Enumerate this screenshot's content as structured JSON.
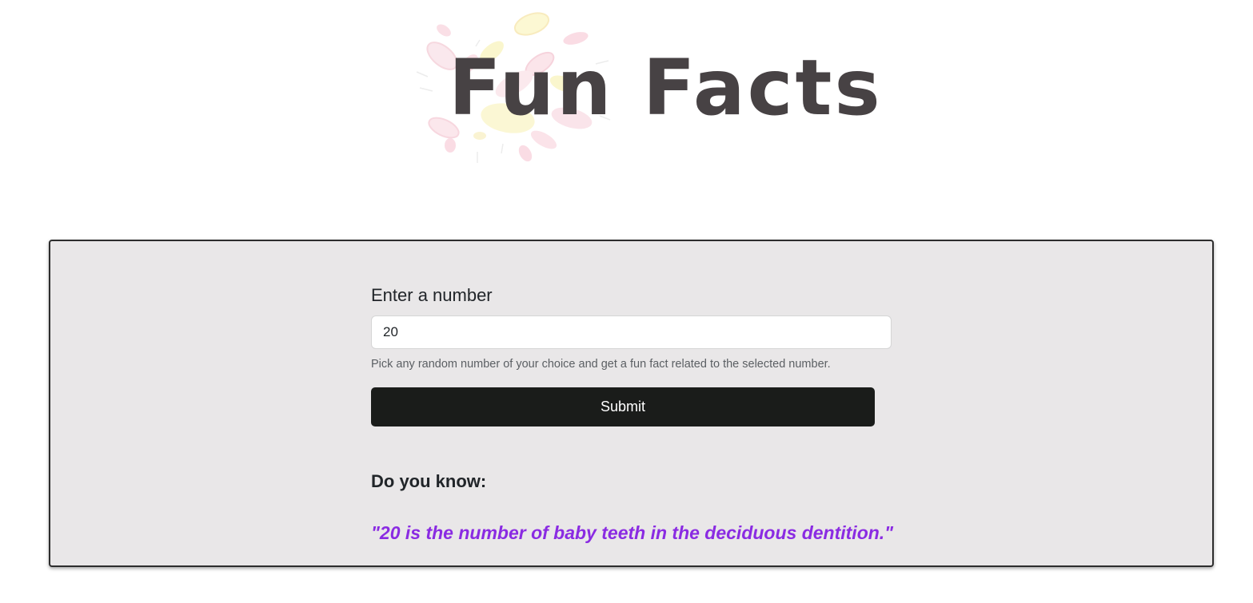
{
  "header": {
    "logo_title": "Fun Facts"
  },
  "form": {
    "label": "Enter a number",
    "input_value": "20",
    "help_text": "Pick any random number of your choice and get a fun fact related to the selected number.",
    "submit_label": "Submit"
  },
  "result": {
    "heading": "Do you know:",
    "fact": "\"20 is the number of baby teeth in the deciduous dentition.\""
  },
  "colors": {
    "title": "#474244",
    "card_background": "#e9e7e8",
    "button_background": "#1a1c1a",
    "fact_text": "#8a2be2"
  }
}
